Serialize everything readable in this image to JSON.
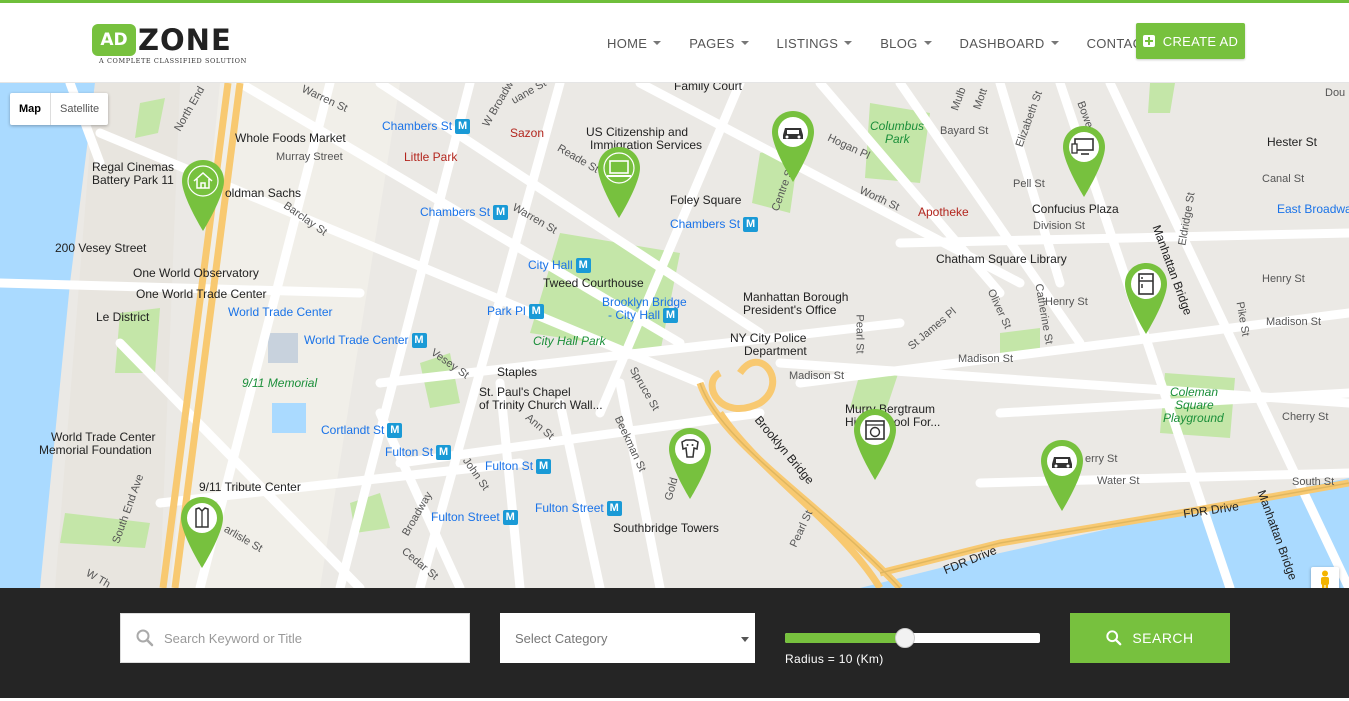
{
  "brand": {
    "logo_ad": "AD",
    "logo_zone": "ZONE",
    "tagline": "A COMPLETE CLASSIFIED SOLUTION",
    "accent_color": "#77c13e"
  },
  "nav": {
    "items": [
      {
        "label": "HOME",
        "dropdown": true
      },
      {
        "label": "PAGES",
        "dropdown": true
      },
      {
        "label": "LISTINGS",
        "dropdown": true
      },
      {
        "label": "BLOG",
        "dropdown": true
      },
      {
        "label": "DASHBOARD",
        "dropdown": true
      },
      {
        "label": "CONTACT",
        "dropdown": false
      }
    ],
    "create_ad_label": "CREATE AD"
  },
  "map": {
    "type_buttons": [
      "Map",
      "Satellite"
    ],
    "active_type": "Map",
    "labels": {
      "whole_foods": "Whole Foods Market",
      "chambers_st_1": "Chambers St",
      "sazon": "Sazon",
      "family_court": "Family Court",
      "us_citizenship": "US Citizenship and",
      "immigration": "Immigration Services",
      "columbus_park": "Columbus",
      "columbus_park2": "Park",
      "regal": "Regal Cinemas",
      "battery": "Battery Park 11",
      "goldman": "oldman Sachs",
      "little_park": "Little Park",
      "murray": "Murray Street",
      "foley": "Foley Square",
      "apotheke": "Apotheke",
      "confucius": "Confucius Plaza",
      "hester": "Hester St",
      "vesey200": "200 Vesey Street",
      "chambers_st_2": "Chambers St",
      "chambers_st_3": "Chambers St",
      "city_hall": "City Hall",
      "tweed": "Tweed Courthouse",
      "chatham": "Chatham Square Library",
      "one_wtc_obs": "One World Observatory",
      "one_wtc": "One World Trade Center",
      "le_district": "Le District",
      "wtc_station": "World Trade Center",
      "wtc_station2": "World Trade Center",
      "brooklyn_bridge_ch": "Brooklyn Bridge",
      "brooklyn_bridge_ch2": "- City Hall",
      "park_pl": "Park Pl",
      "manhattan_borough": "Manhattan Borough",
      "presidents_office": "President's Office",
      "nypd": "NY City Police",
      "nypd2": "Department",
      "city_hall_park": "City Hall Park",
      "memorial_911": "9/11 Memorial",
      "staples": "Staples",
      "st_pauls": "St. Paul's Chapel",
      "trinity": "of Trinity Church Wall...",
      "murry": "Murry Bergtraum",
      "school": "High School For...",
      "coleman": "Coleman",
      "coleman2": "Square",
      "coleman3": "Playground",
      "wtc_memorial": "World Trade Center",
      "wtc_memorial2": "Memorial Foundation",
      "cortlandt": "Cortlandt St",
      "fulton_st_1": "Fulton St",
      "fulton_st_2": "Fulton St",
      "fulton_street_1": "Fulton Street",
      "fulton_street_2": "Fulton Street",
      "tribute": "9/11 Tribute Center",
      "southbridge": "Southbridge Towers",
      "fdr": "FDR Drive",
      "fdr2": "FDR Drive",
      "brooklyn_bridge": "Brooklyn Bridge",
      "manhattan_bridge": "Manhattan Bridge",
      "manhattan_bridge2": "Manhattan Bridge",
      "east_broadway": "East Broadwa",
      "henry_st": "Henry St",
      "henry_st2": "Henry St",
      "madison_st": "Madison St",
      "madison_st2": "Madison St",
      "madison_st3": "Madison St",
      "cherry_st": "Cherry St",
      "cherry_st2": "erry St",
      "water_st": "Water St",
      "south_st": "South St",
      "pearl_st": "Pearl St",
      "pearl_st2": "Pearl St",
      "canal_st": "Canal St",
      "bayard": "Bayard St",
      "pell": "Pell St",
      "division": "Division St",
      "worth": "Worth St",
      "hogan": "Hogan Pl",
      "centre": "Centre St",
      "reade": "Reade St",
      "warren": "Warren St",
      "warren2": "Warren St",
      "barclay": "Barclay St",
      "vesey": "Vesey St",
      "ann": "Ann St",
      "spruce": "Spruce St",
      "beekman": "Beekman St",
      "john": "John St",
      "broadway": "Broadway",
      "cedar": "Cedar St",
      "carlisle": "arlisle St",
      "south_end": "South End Ave",
      "catherine": "Catherine St",
      "oliver": "Oliver St",
      "st_james": "St James Pl",
      "pike": "Pike St",
      "eldridge": "Eldridge St",
      "elizabeth": "Elizabeth St",
      "mott": "Mott",
      "mulb": "Mulb",
      "north_end": "North End",
      "w_broadway": "W Broadway",
      "duane": "uane St",
      "gold": "Gold",
      "bowery": "Bowery",
      "dou": "Dou",
      "w_th": "W Th"
    },
    "pins": [
      {
        "name": "house-pin",
        "icon": "house"
      },
      {
        "name": "laptop-pin",
        "icon": "laptop"
      },
      {
        "name": "car-pin-1",
        "icon": "car"
      },
      {
        "name": "computer-pin",
        "icon": "computer"
      },
      {
        "name": "fridge-pin",
        "icon": "fridge"
      },
      {
        "name": "washer-pin",
        "icon": "washer"
      },
      {
        "name": "car-pin-2",
        "icon": "car"
      },
      {
        "name": "dog-pin",
        "icon": "dog"
      },
      {
        "name": "shirt-pin",
        "icon": "shirt"
      }
    ]
  },
  "search": {
    "keyword_placeholder": "Search Keyword or Title",
    "category_selected": "Select Category",
    "radius_label": "Radius = 10 (Km)",
    "radius_fraction": 0.47,
    "search_label": "SEARCH"
  }
}
